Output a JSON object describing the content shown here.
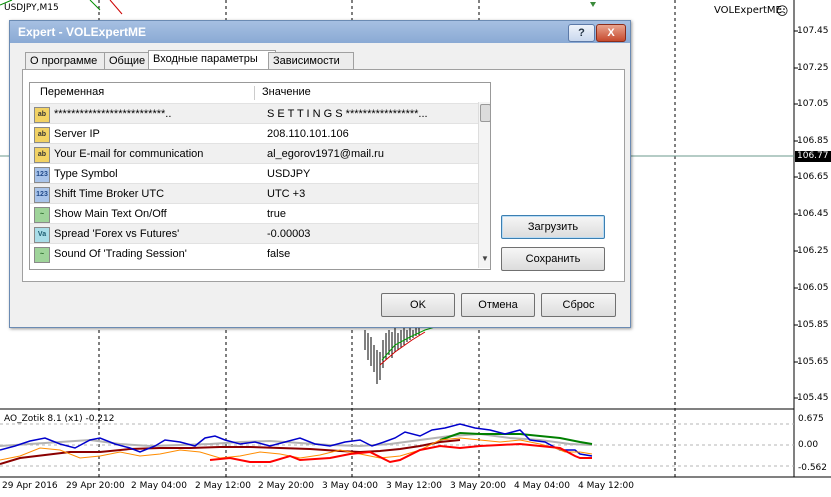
{
  "chart": {
    "symbol_title": "USDJPY,M15",
    "ea_name": "VOLExpertME",
    "current_price": "106.77",
    "price_scale": [
      "107.45",
      "107.25",
      "107.05",
      "106.85",
      "106.65",
      "106.45",
      "106.25",
      "106.05",
      "105.85",
      "105.65",
      "105.45"
    ],
    "time_labels": [
      "29 Apr 2016",
      "29 Apr 20:00",
      "2 May 04:00",
      "2 May 12:00",
      "2 May 20:00",
      "3 May 04:00",
      "3 May 12:00",
      "3 May 20:00",
      "4 May 04:00",
      "4 May 12:00"
    ],
    "indicator": {
      "title": "AO_Zotik 8.1 (x1) -0.212",
      "levels": [
        "0.675",
        "0.00",
        "-0.562"
      ],
      "colors": {
        "blue": "#0000cc",
        "red": "#ff0000",
        "orange": "#ff8c00",
        "darkred": "#8b0000",
        "green": "#008000",
        "gray": "#b4b4b4"
      }
    }
  },
  "dialog": {
    "title": "Expert - VOLExpertME",
    "help_label": "?",
    "close_label": "X",
    "tabs": [
      "О программе",
      "Общие",
      "Входные параметры",
      "Зависимости"
    ],
    "active_tab": "Входные параметры",
    "columns": {
      "variable": "Переменная",
      "value": "Значение"
    },
    "params": [
      {
        "icon": "ab",
        "name": "**************************..",
        "value": "S E T T I N G S *****************..."
      },
      {
        "icon": "ab",
        "name": "Server IP",
        "value": "208.110.101.106"
      },
      {
        "icon": "ab",
        "name": "Your E-mail for communication",
        "value": "al_egorov1971@mail.ru"
      },
      {
        "icon": "123",
        "name": "Type Symbol",
        "value": "USDJPY"
      },
      {
        "icon": "123",
        "name": "Shift Time Broker UTC",
        "value": "UTC +3"
      },
      {
        "icon": "bool",
        "name": "Show Main Text On/Off",
        "value": "true"
      },
      {
        "icon": "Va",
        "name": "Spread 'Forex vs Futures'",
        "value": "-0.00003"
      },
      {
        "icon": "bool",
        "name": "Sound Of 'Trading Session'",
        "value": "false"
      }
    ],
    "buttons": {
      "load": "Загрузить",
      "save": "Сохранить",
      "ok": "OK",
      "cancel": "Отмена",
      "reset": "Сброс"
    }
  }
}
